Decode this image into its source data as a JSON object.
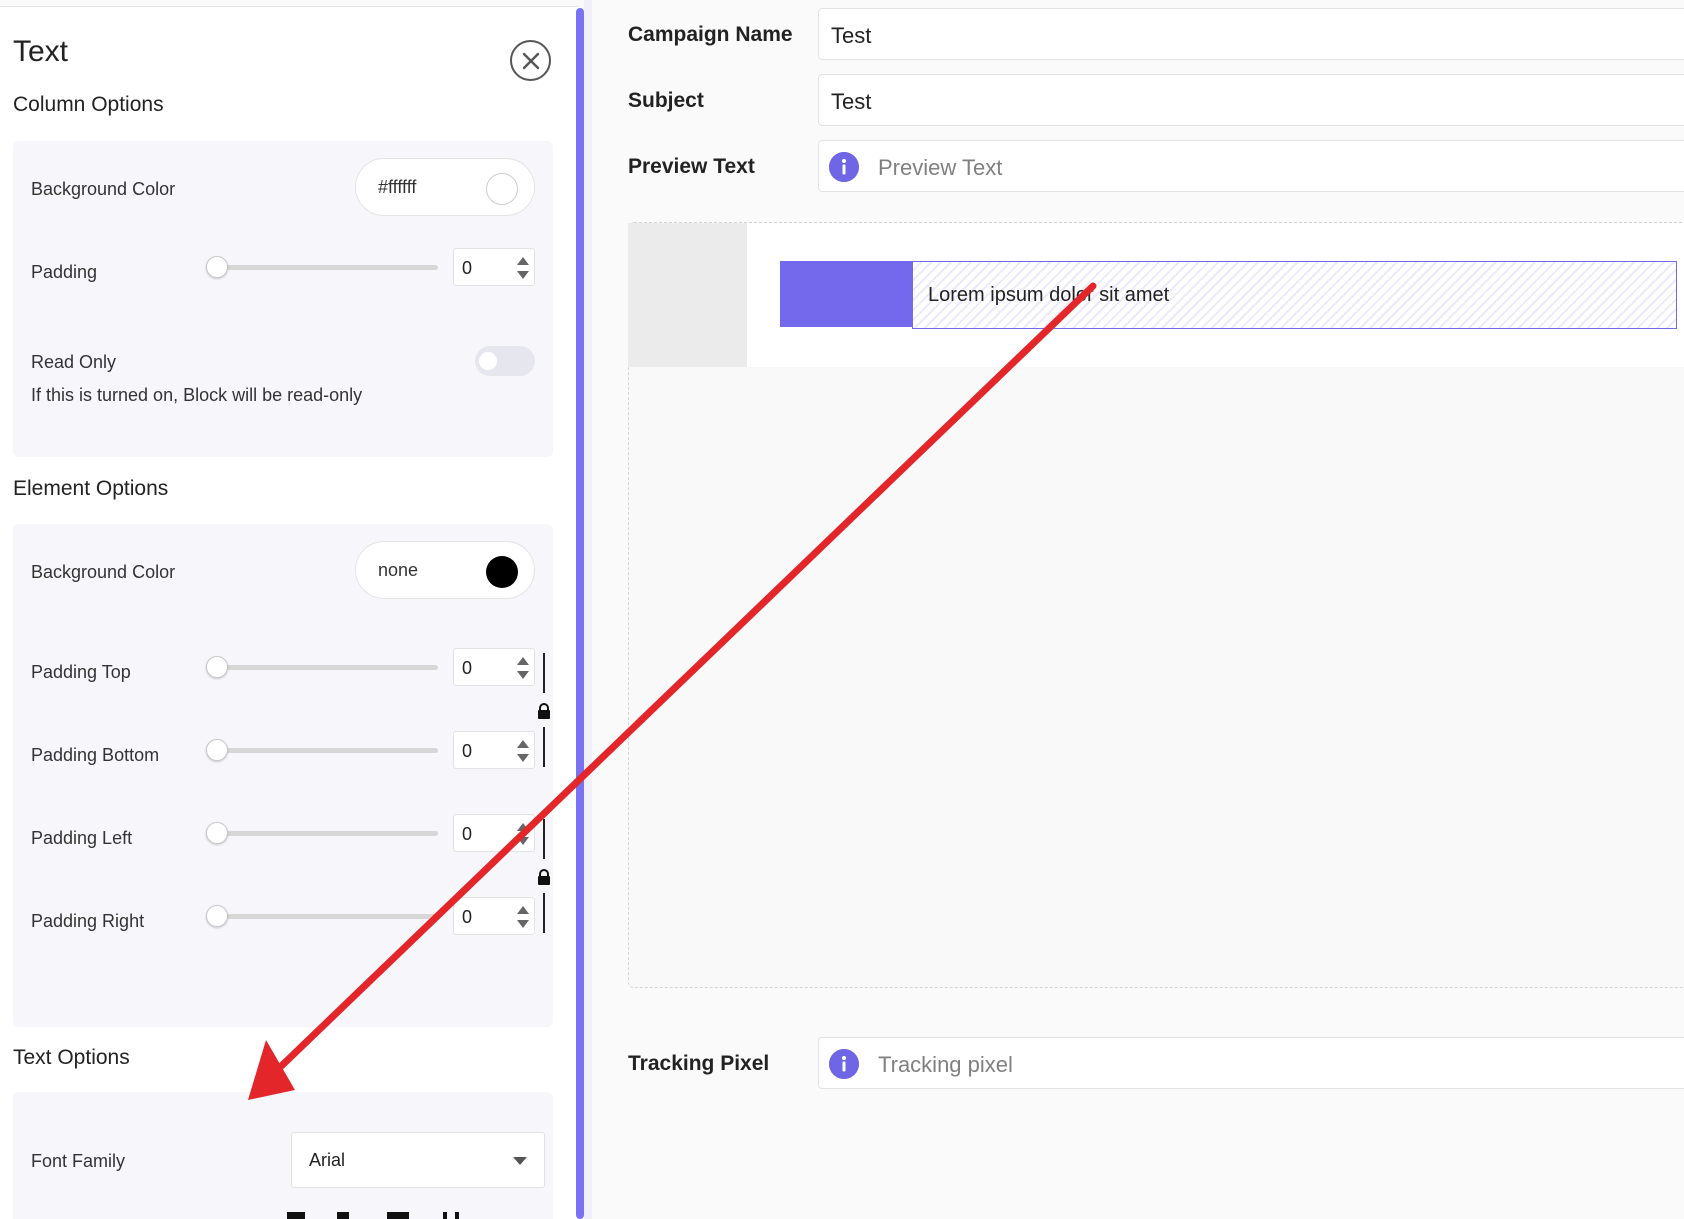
{
  "panel": {
    "title": "Text",
    "column_options": {
      "title": "Column Options",
      "background_color": {
        "label": "Background Color",
        "value": "#ffffff",
        "swatch": "#ffffff"
      },
      "padding": {
        "label": "Padding",
        "value": "0"
      },
      "read_only": {
        "label": "Read Only",
        "hint": "If this is turned on, Block will be read-only",
        "on": false
      }
    },
    "element_options": {
      "title": "Element Options",
      "background_color": {
        "label": "Background Color",
        "value": "none",
        "swatch": "#000000"
      },
      "padding_top": {
        "label": "Padding Top",
        "value": "0"
      },
      "padding_bottom": {
        "label": "Padding Bottom",
        "value": "0"
      },
      "padding_left": {
        "label": "Padding Left",
        "value": "0"
      },
      "padding_right": {
        "label": "Padding Right",
        "value": "0"
      }
    },
    "text_options": {
      "title": "Text Options",
      "font_family": {
        "label": "Font Family",
        "value": "Arial"
      }
    }
  },
  "form": {
    "campaign_name": {
      "label": "Campaign Name",
      "value": "Test"
    },
    "subject": {
      "label": "Subject",
      "value": "Test"
    },
    "preview_text": {
      "label": "Preview Text",
      "placeholder": "Preview Text"
    },
    "tracking_pixel": {
      "label": "Tracking Pixel",
      "placeholder": "Tracking pixel"
    }
  },
  "editor": {
    "text_block": "Lorem ipsum dolor sit amet"
  },
  "colors": {
    "accent": "#7468ec",
    "arrow": "#e3262a"
  }
}
